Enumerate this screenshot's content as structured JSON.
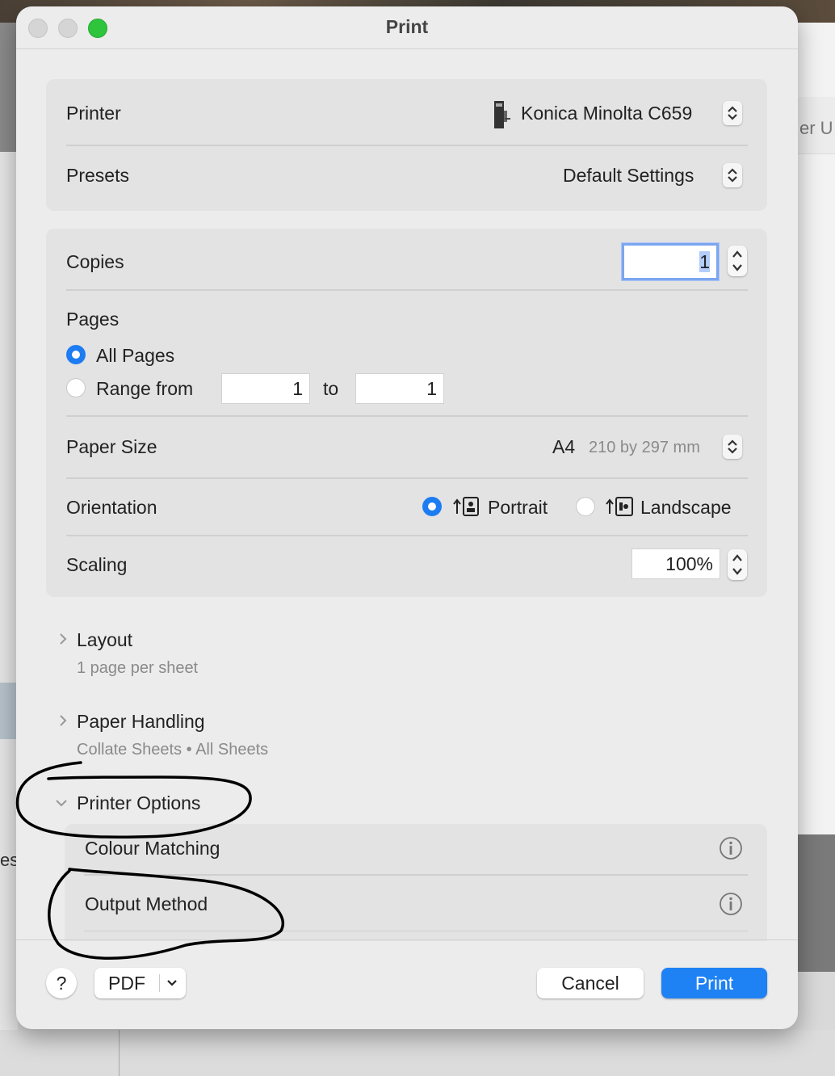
{
  "background": {
    "right_snippet": "er U",
    "left_snippet": "es"
  },
  "window": {
    "title": "Print"
  },
  "printer": {
    "label": "Printer",
    "value": "Konica Minolta C659"
  },
  "presets": {
    "label": "Presets",
    "value": "Default Settings"
  },
  "copies": {
    "label": "Copies",
    "value": "1"
  },
  "pages": {
    "label": "Pages",
    "all_label": "All Pages",
    "range_label": "Range from",
    "range_from": "1",
    "to_label": "to",
    "range_to": "1",
    "selected": "all"
  },
  "paper_size": {
    "label": "Paper Size",
    "value": "A4",
    "detail": "210 by 297 mm"
  },
  "orientation": {
    "label": "Orientation",
    "portrait_label": "Portrait",
    "landscape_label": "Landscape",
    "selected": "portrait"
  },
  "scaling": {
    "label": "Scaling",
    "value": "100%"
  },
  "layout": {
    "label": "Layout",
    "summary": "1 page per sheet",
    "expanded": false
  },
  "paper_handling": {
    "label": "Paper Handling",
    "summary": "Collate Sheets • All Sheets",
    "expanded": false
  },
  "printer_options": {
    "label": "Printer Options",
    "expanded": true,
    "items": [
      {
        "label": "Colour Matching"
      },
      {
        "label": "Output Method"
      }
    ]
  },
  "footer": {
    "help": "?",
    "pdf_label": "PDF",
    "cancel_label": "Cancel",
    "print_label": "Print"
  },
  "colors": {
    "accent": "#1f82f4",
    "annotation_ink": "#000000",
    "zoom_green": "#2ec53c"
  }
}
